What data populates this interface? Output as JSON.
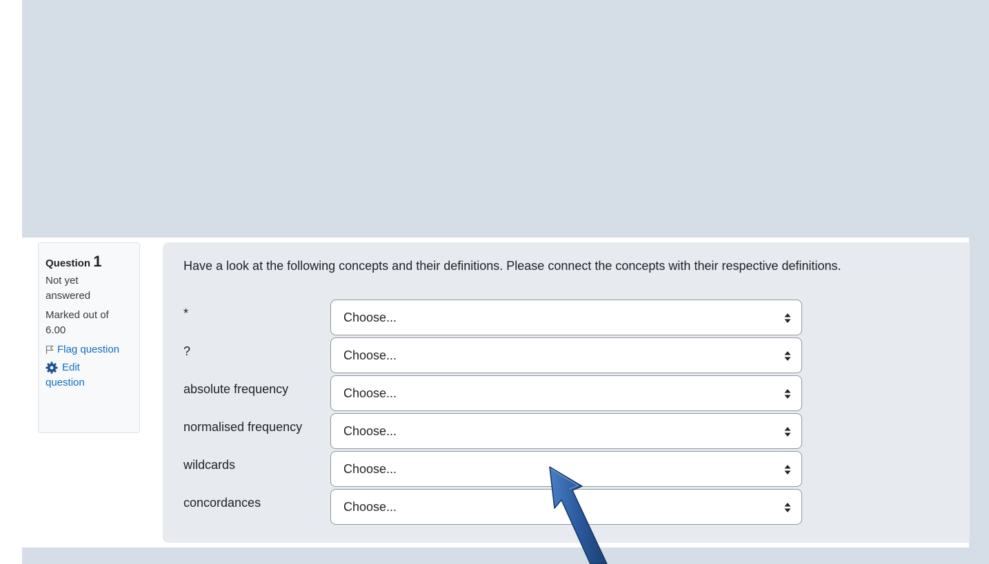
{
  "question_info": {
    "label": "Question",
    "number": "1",
    "state_line1": "Not yet",
    "state_line2": "answered",
    "grade_line1": "Marked out of",
    "grade_line2": "6.00",
    "flag_label": "Flag question",
    "edit_line1": "Edit",
    "edit_line2": "question"
  },
  "question_text": "Have a look at the following concepts and their definitions. Please connect the concepts with their respective definitions.",
  "rows": [
    {
      "label": "*",
      "selected": "Choose..."
    },
    {
      "label": "?",
      "selected": "Choose..."
    },
    {
      "label": "absolute frequency",
      "selected": "Choose..."
    },
    {
      "label": "normalised frequency",
      "selected": "Choose..."
    },
    {
      "label": "wildcards",
      "selected": "Choose..."
    },
    {
      "label": "concordances",
      "selected": "Choose..."
    }
  ],
  "icons": {
    "flag": "flag-icon",
    "edit": "gear-icon",
    "select_arrow": "sort-arrows-icon",
    "overlay": "pointer-arrow-annotation"
  },
  "colors": {
    "page_background": "#d5dde6",
    "formulation_background": "#e7ebf0",
    "link": "#0f6cbf",
    "arrow": "#2a5a9e"
  }
}
